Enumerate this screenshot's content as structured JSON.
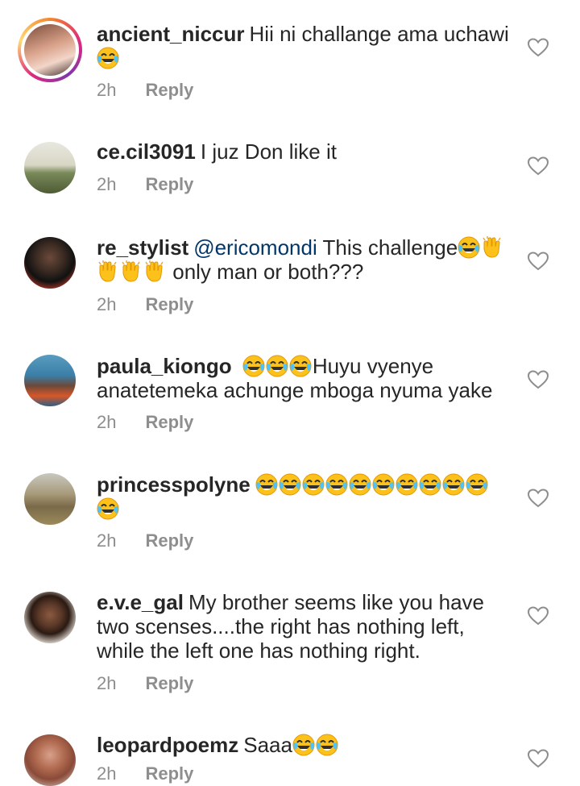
{
  "comments": [
    {
      "username": "ancient_niccur",
      "text": "Hii ni challange ama uchawi",
      "time": "2h",
      "reply": "Reply"
    },
    {
      "username": "ce.cil3091",
      "text": "I juz Don like it",
      "time": "2h",
      "reply": "Reply"
    },
    {
      "username": "re_stylist",
      "mention": "@ericomondi",
      "text": "This challenge",
      "text2": "only man or both???",
      "time": "2h",
      "reply": "Reply"
    },
    {
      "username": "paula_kiongo",
      "text": "Huyu vyenye",
      "text2": "anatetemeka achunge mboga nyuma yake",
      "time": "2h",
      "reply": "Reply"
    },
    {
      "username": "princesspolyne",
      "text": "",
      "time": "2h",
      "reply": "Reply"
    },
    {
      "username": "e.v.e_gal",
      "text": "My brother seems like you have",
      "text2": "two scenses....the right has nothing left,",
      "text3": "while the left one has nothing right.",
      "time": "2h",
      "reply": "Reply"
    },
    {
      "username": "leopardpoemz",
      "text": "Saaa",
      "time": "2h",
      "reply": "Reply"
    }
  ],
  "icons": {
    "emoji": "face-with-tears-of-joy",
    "clap": "raising-hands",
    "like": "heart-outline"
  },
  "colors": {
    "text": "#262626",
    "meta": "#8e8e8e",
    "mention": "#00376b"
  }
}
